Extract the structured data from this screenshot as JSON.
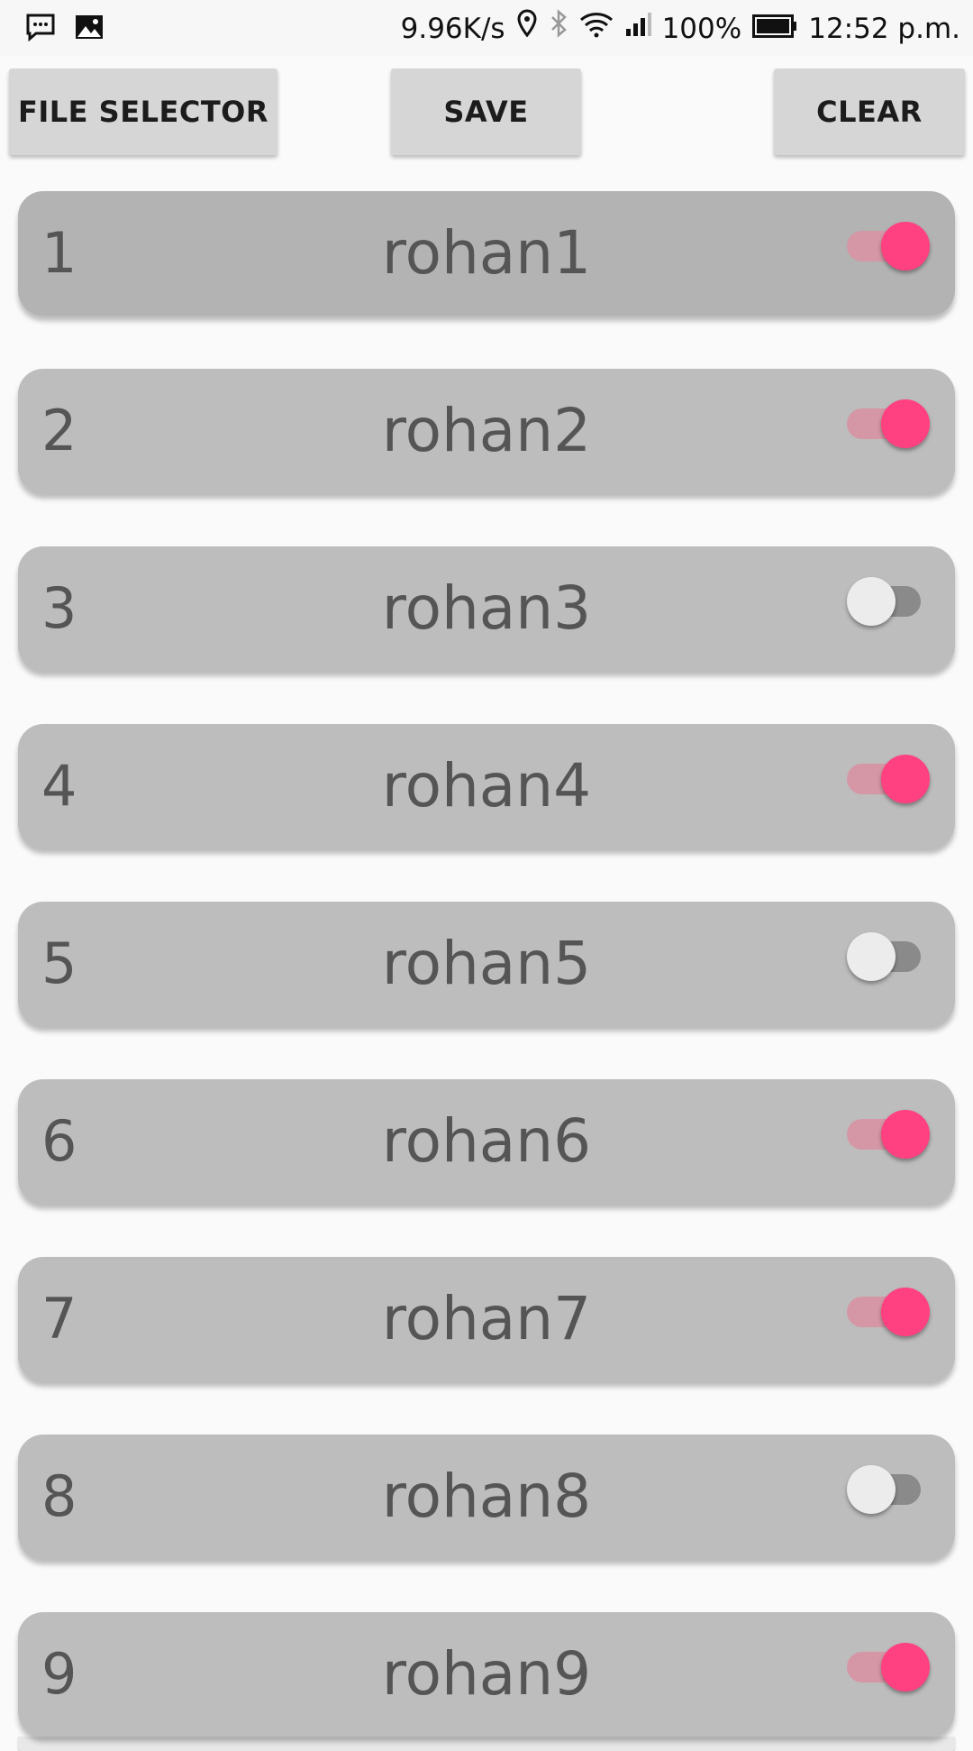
{
  "status_bar": {
    "network_speed": "9.96K/s",
    "battery": "100%",
    "time": "12:52 p.m.",
    "icons": [
      "message-icon",
      "image-icon",
      "location-icon",
      "bluetooth-icon",
      "wifi-icon",
      "signal-icon",
      "battery-icon"
    ]
  },
  "toolbar": {
    "file_selector_label": "FILE SELECTOR",
    "save_label": "SAVE",
    "clear_label": "CLEAR"
  },
  "items": [
    {
      "index": "1",
      "name": "rohan1",
      "enabled": true
    },
    {
      "index": "2",
      "name": "rohan2",
      "enabled": true
    },
    {
      "index": "3",
      "name": "rohan3",
      "enabled": false
    },
    {
      "index": "4",
      "name": "rohan4",
      "enabled": true
    },
    {
      "index": "5",
      "name": "rohan5",
      "enabled": false
    },
    {
      "index": "6",
      "name": "rohan6",
      "enabled": true
    },
    {
      "index": "7",
      "name": "rohan7",
      "enabled": true
    },
    {
      "index": "8",
      "name": "rohan8",
      "enabled": false
    },
    {
      "index": "9",
      "name": "rohan9",
      "enabled": true
    }
  ],
  "colors": {
    "accent": "#ff4081",
    "row_background": "#bdbdbd",
    "button_background": "#d5d6d5"
  }
}
